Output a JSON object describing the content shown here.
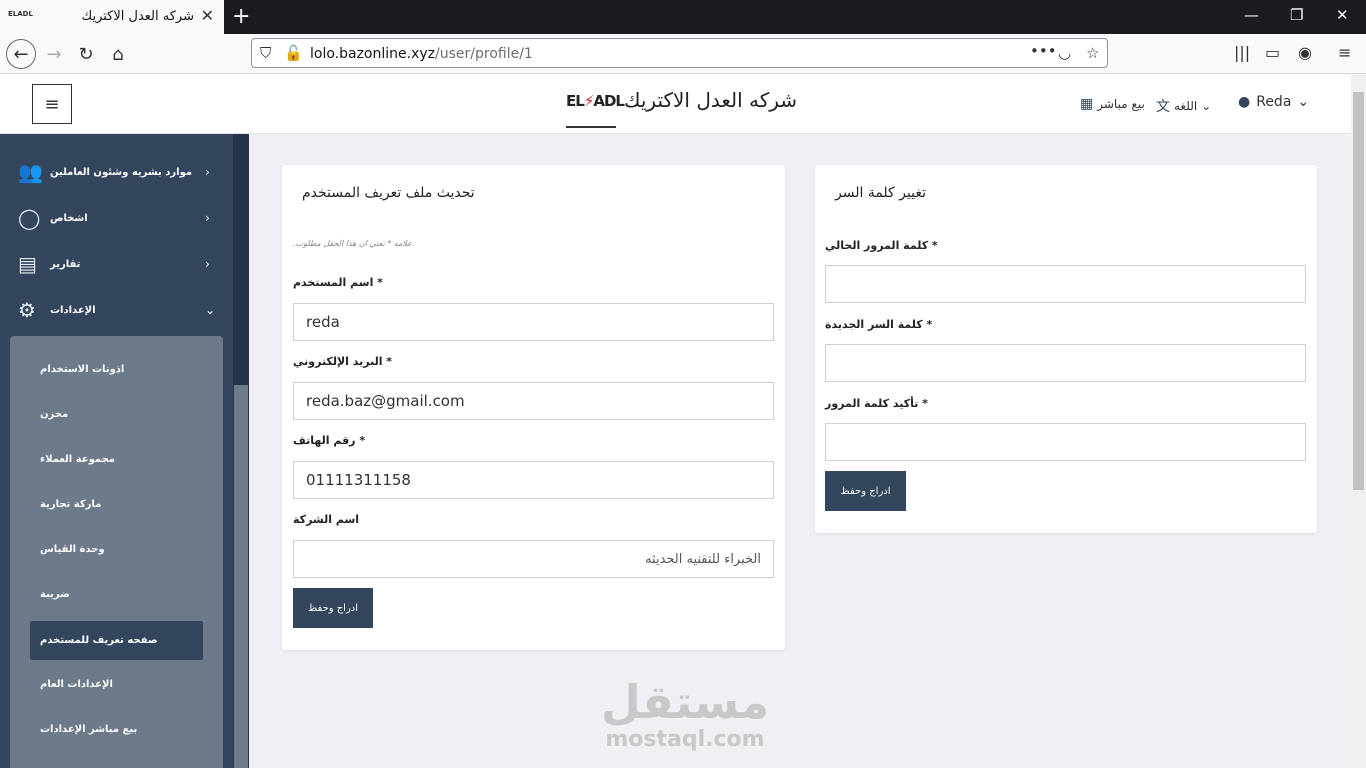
{
  "browser": {
    "tab_title": "شركه العدل الاكتريك",
    "favicon_text": "ELADL",
    "url_host": "lolo.bazonline.xyz",
    "url_path": "/user/profile/1"
  },
  "header": {
    "company_name": "شركه العدل الاكتريك",
    "logo_text_left": "EL",
    "logo_text_right": "ADL",
    "direct_sale": "بيع مباشر",
    "language": "اللغه",
    "user_name": "Reda"
  },
  "sidebar": {
    "items": [
      {
        "label": "موارد بشريه وشئون العاملين",
        "icon": "users-icon"
      },
      {
        "label": "اشخاص",
        "icon": "user-icon"
      },
      {
        "label": "تقارير",
        "icon": "report-icon"
      },
      {
        "label": "الإعدادات",
        "icon": "gear-icon"
      }
    ],
    "submenu": [
      "اذونات الاستخدام",
      "مخزن",
      "مجموعة العملاء",
      "ماركة تجارية",
      "وحدة القياس",
      "ضريبة",
      "صفحه تعريف للمستخدم",
      "الإعدادات العام",
      "بيع مباشر الإعدادات"
    ],
    "active_submenu": "صفحه تعريف للمستخدم"
  },
  "profile_form": {
    "title": "تحديث ملف تعريف المستخدم",
    "required_note": "علامه * تعني ان هذا الحقل مطلوب.",
    "username_label": "* اسم المستخدم",
    "username_value": "reda",
    "email_label": "* البريد الإلكتروني",
    "email_value": "reda.baz@gmail.com",
    "phone_label": "* رقم الهاتف",
    "phone_value": "01111311158",
    "company_label": "اسم الشركة",
    "company_value": "الخبراء للتقنيه الحديثه",
    "submit_label": "ادراج وحفظ"
  },
  "password_form": {
    "title": "تغيير كلمة السر",
    "current_label": "* كلمة المرور الحالي",
    "new_label": "* كلمة السر الجديدة",
    "confirm_label": "* تأكيد كلمة المرور",
    "submit_label": "ادراج وحفظ"
  },
  "watermark": {
    "arabic": "مستقل",
    "latin": "mostaql.com"
  }
}
